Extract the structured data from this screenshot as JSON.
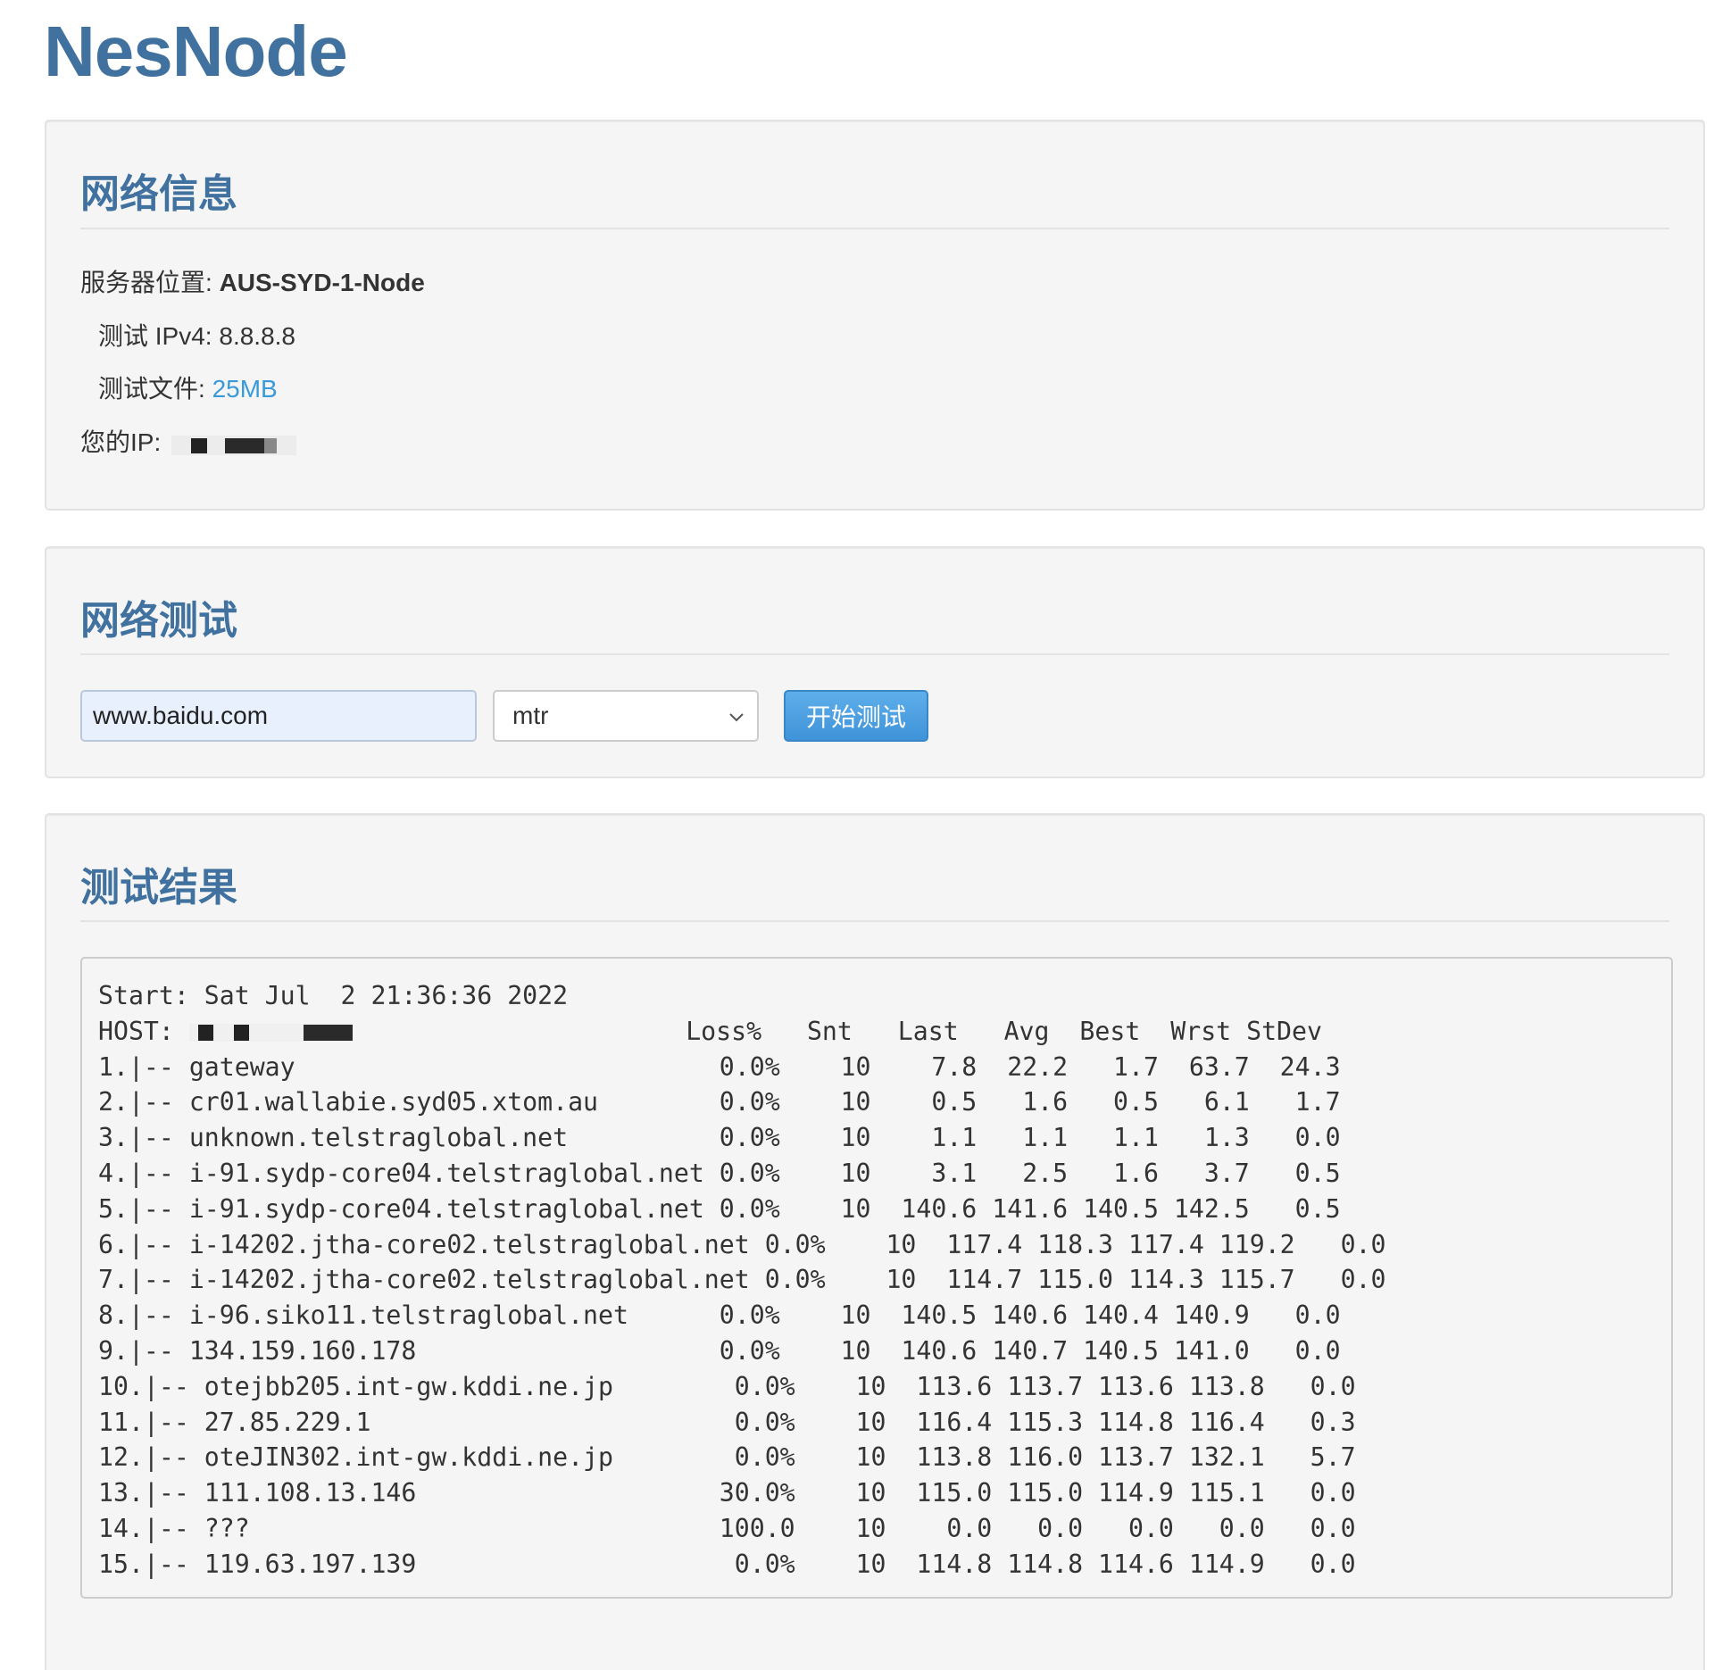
{
  "site": {
    "title": "NesNode"
  },
  "network_info": {
    "heading": "网络信息",
    "location_label": "服务器位置:",
    "location_value": "AUS-SYD-1-Node",
    "ipv4_label": "测试 IPv4:",
    "ipv4_value": "8.8.8.8",
    "file_label": "测试文件:",
    "file_value": "25MB",
    "your_ip_label": "您的IP:"
  },
  "network_test": {
    "heading": "网络测试",
    "host_value": "www.baidu.com",
    "mode_value": "mtr",
    "start_label": "开始测试"
  },
  "test_result": {
    "heading": "测试结果",
    "start_line": "Start: Sat Jul  2 21:36:36 2022",
    "host_label": "HOST:",
    "header_columns": "Loss%   Snt   Last   Avg  Best  Wrst StDev",
    "hops": [
      "1.|-- gateway                            0.0%    10    7.8  22.2   1.7  63.7  24.3",
      "2.|-- cr01.wallabie.syd05.xtom.au        0.0%    10    0.5   1.6   0.5   6.1   1.7",
      "3.|-- unknown.telstraglobal.net          0.0%    10    1.1   1.1   1.1   1.3   0.0",
      "4.|-- i-91.sydp-core04.telstraglobal.net 0.0%    10    3.1   2.5   1.6   3.7   0.5",
      "5.|-- i-91.sydp-core04.telstraglobal.net 0.0%    10  140.6 141.6 140.5 142.5   0.5",
      "6.|-- i-14202.jtha-core02.telstraglobal.net 0.0%    10  117.4 118.3 117.4 119.2   0.0",
      "7.|-- i-14202.jtha-core02.telstraglobal.net 0.0%    10  114.7 115.0 114.3 115.7   0.0",
      "8.|-- i-96.siko11.telstraglobal.net      0.0%    10  140.5 140.6 140.4 140.9   0.0",
      "9.|-- 134.159.160.178                    0.0%    10  140.6 140.7 140.5 141.0   0.0",
      "10.|-- otejbb205.int-gw.kddi.ne.jp        0.0%    10  113.6 113.7 113.6 113.8   0.0",
      "11.|-- 27.85.229.1                        0.0%    10  116.4 115.3 114.8 116.4   0.3",
      "12.|-- oteJIN302.int-gw.kddi.ne.jp        0.0%    10  113.8 116.0 113.7 132.1   5.7",
      "13.|-- 111.108.13.146                    30.0%    10  115.0 115.0 114.9 115.1   0.0",
      "14.|-- ???                               100.0    10    0.0   0.0   0.0   0.0   0.0",
      "15.|-- 119.63.197.139                     0.0%    10  114.8 114.8 114.6 114.9   0.0"
    ]
  },
  "colors": {
    "brand": "#41729f",
    "link": "#3a9ad9",
    "button": "#4a9fe0",
    "panel_bg": "#f5f5f5"
  },
  "icons": {
    "select_arrow": "chevron-down-icon"
  }
}
